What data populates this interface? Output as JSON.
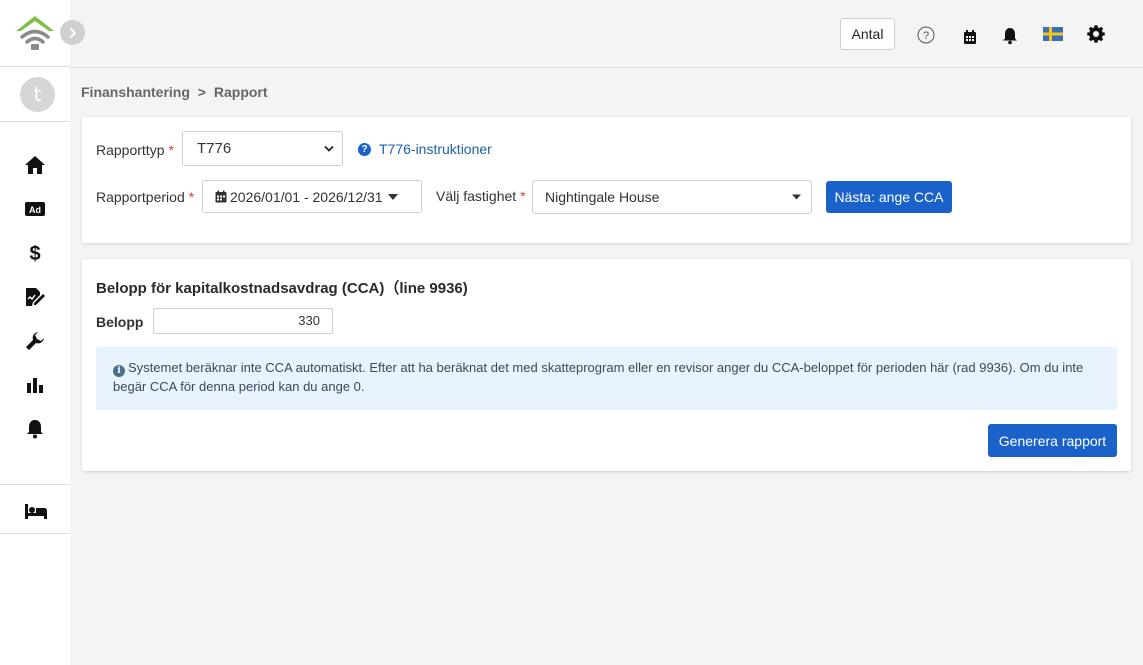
{
  "topbar": {
    "antal_label": "Antal",
    "icons": [
      "help-icon",
      "calendar-icon",
      "bell-icon",
      "swedish-flag-icon",
      "gear-icon"
    ]
  },
  "sidebar": {
    "avatar_initial": "t",
    "items": [
      "home-icon",
      "ad-icon",
      "dollar-icon",
      "document-edit-icon",
      "wrench-icon",
      "bar-chart-icon",
      "bell-icon",
      "bed-icon"
    ]
  },
  "breadcrumb": {
    "parent": "Finanshantering",
    "separator": ">",
    "current": "Rapport"
  },
  "report_form": {
    "type_label": "Rapporttyp",
    "type_value": "T776",
    "instructions_link": "T776-instruktioner",
    "period_label": "Rapportperiod",
    "period_value": "2026/01/01 - 2026/12/31",
    "property_label": "Välj fastighet",
    "property_value": "Nightingale House",
    "next_button": "Nästa: ange CCA",
    "required_mark": "*"
  },
  "cca_section": {
    "title": "Belopp för kapitalkostnadsavdrag (CCA)（line 9936)",
    "amount_label": "Belopp",
    "amount_value": "330",
    "info_text": "Systemet beräknar inte CCA automatiskt. Efter att ha beräknat det med skatteprogram eller en revisor anger du CCA-beloppet för perioden här (rad 9936). Om du inte begär CCA för denna period kan du ange 0.",
    "generate_button": "Generera rapport"
  },
  "colors": {
    "primary": "#1a62c9",
    "logo_green": "#7cc04b",
    "required": "#e03a3a",
    "info_bg": "#e8f3fd"
  }
}
